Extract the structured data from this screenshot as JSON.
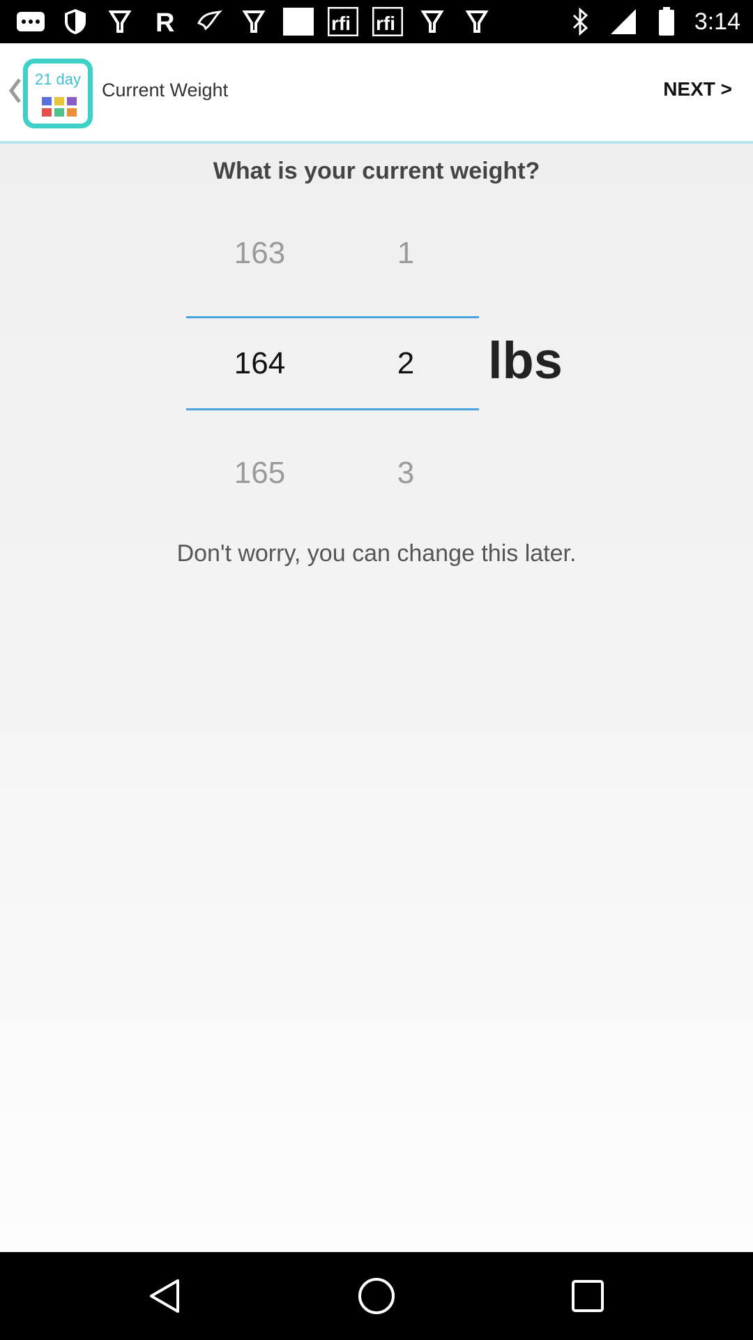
{
  "status_bar": {
    "time": "3:14",
    "left_icons": [
      "messages-icon",
      "shield-icon",
      "pin-icon",
      "r-app-icon",
      "bird-icon",
      "pin-icon",
      "image-icon",
      "rfi-icon",
      "rfi-icon",
      "pin-icon",
      "pin-icon"
    ],
    "right_icons": [
      "bluetooth-icon",
      "signal-icon",
      "battery-icon"
    ]
  },
  "app_bar": {
    "logo_text": "21 day",
    "logo_colors": [
      "#5a6fd8",
      "#e7c43a",
      "#8a5cc7",
      "#e0524a",
      "#4ec28a",
      "#e98f3a"
    ],
    "title": "Current Weight",
    "next_label": "NEXT >"
  },
  "main": {
    "question": "What is your current weight?",
    "picker": {
      "whole": {
        "above": "163",
        "selected": "164",
        "below": "165"
      },
      "decimal": {
        "above": "1",
        "selected": "2",
        "below": "3"
      },
      "unit": "lbs"
    },
    "hint": "Don't worry, you can change this later."
  },
  "colors": {
    "accent": "#4aa3dd",
    "logo_teal": "#3fd1c8"
  }
}
